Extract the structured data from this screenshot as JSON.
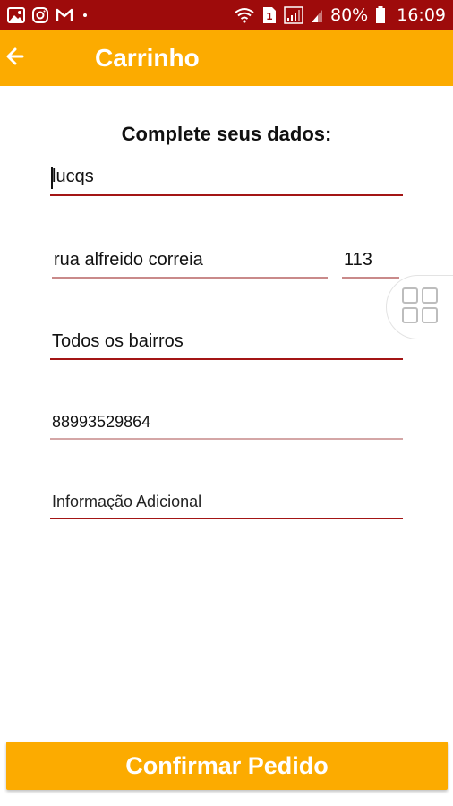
{
  "status_bar": {
    "battery_text": "80%",
    "time": "16:09",
    "sim_badge": "1",
    "icons_left": [
      "image-icon",
      "instagram-icon",
      "gmail-icon",
      "dot-icon"
    ],
    "icons_right": [
      "wifi-icon",
      "sim-icon",
      "signal-icon",
      "battery-icon"
    ],
    "color": "#9e0b0b"
  },
  "app_bar": {
    "title": "Carrinho",
    "back_icon": "arrow-left-icon",
    "color": "#fcab00"
  },
  "form": {
    "heading": "Complete seus dados:",
    "name": {
      "value": "lucqs",
      "placeholder": ""
    },
    "street": {
      "value": "rua alfreido correia",
      "placeholder": ""
    },
    "number": {
      "value": "113",
      "placeholder": ""
    },
    "neighborhood": {
      "value": "Todos os bairros",
      "placeholder": ""
    },
    "phone": {
      "value": "88993529864",
      "placeholder": ""
    },
    "additional_info": {
      "value": "",
      "placeholder": "Informação Adicional"
    }
  },
  "floating_button": {
    "icon": "grid-icon"
  },
  "confirm_button": {
    "label": "Confirmar Pedido",
    "color": "#fcab00"
  }
}
